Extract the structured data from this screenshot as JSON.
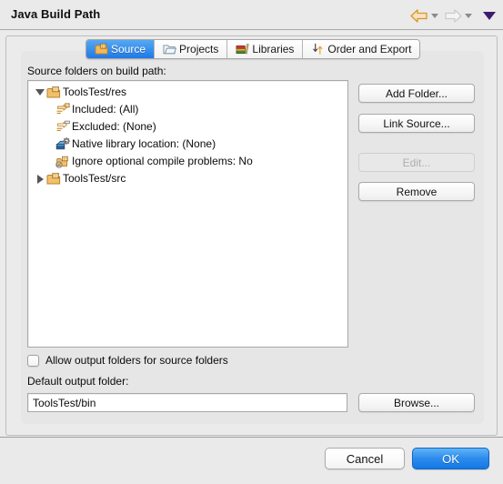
{
  "window": {
    "title": "Java Build Path"
  },
  "titlebar_nav": {
    "back_icon": "back-arrow-icon",
    "back_dropdown_icon": "caret-down-icon",
    "forward_icon": "forward-arrow-icon",
    "forward_dropdown_icon": "caret-down-icon",
    "menu_icon": "view-menu-caret-icon",
    "back_color": "#E8A33D",
    "forward_color": "#CFCFCF",
    "menu_color": "#3B1D6E"
  },
  "tabs": [
    {
      "label": "Source",
      "icon": "source-folder-icon",
      "active": true
    },
    {
      "label": "Projects",
      "icon": "projects-folder-icon",
      "active": false
    },
    {
      "label": "Libraries",
      "icon": "libraries-books-icon",
      "active": false
    },
    {
      "label": "Order and Export",
      "icon": "order-export-arrows-icon",
      "active": false
    }
  ],
  "source_section": {
    "label": "Source folders on build path:",
    "tree": [
      {
        "label": "ToolsTest/res",
        "icon": "source-folder-icon",
        "expanded": true,
        "twisty": "expanded",
        "indent": 0
      },
      {
        "label": "Included: (All)",
        "icon": "included-filter-icon",
        "indent": 1
      },
      {
        "label": "Excluded: (None)",
        "icon": "excluded-filter-icon",
        "indent": 1
      },
      {
        "label": "Native library location: (None)",
        "icon": "native-library-icon",
        "indent": 1
      },
      {
        "label": "Ignore optional compile problems: No",
        "icon": "ignore-problems-icon",
        "indent": 1
      },
      {
        "label": "ToolsTest/src",
        "icon": "source-folder-icon",
        "expanded": false,
        "twisty": "collapsed",
        "indent": 0
      }
    ]
  },
  "side_buttons": {
    "add_folder": "Add Folder...",
    "link_source": "Link Source...",
    "edit": "Edit...",
    "edit_disabled": true,
    "remove": "Remove"
  },
  "options": {
    "allow_output_folders_label": "Allow output folders for source folders",
    "allow_output_folders_checked": false
  },
  "default_output": {
    "label": "Default output folder:",
    "value": "ToolsTest/bin",
    "placeholder": "",
    "browse_label": "Browse..."
  },
  "footer": {
    "cancel": "Cancel",
    "ok": "OK",
    "ok_color": "#1478E4"
  }
}
